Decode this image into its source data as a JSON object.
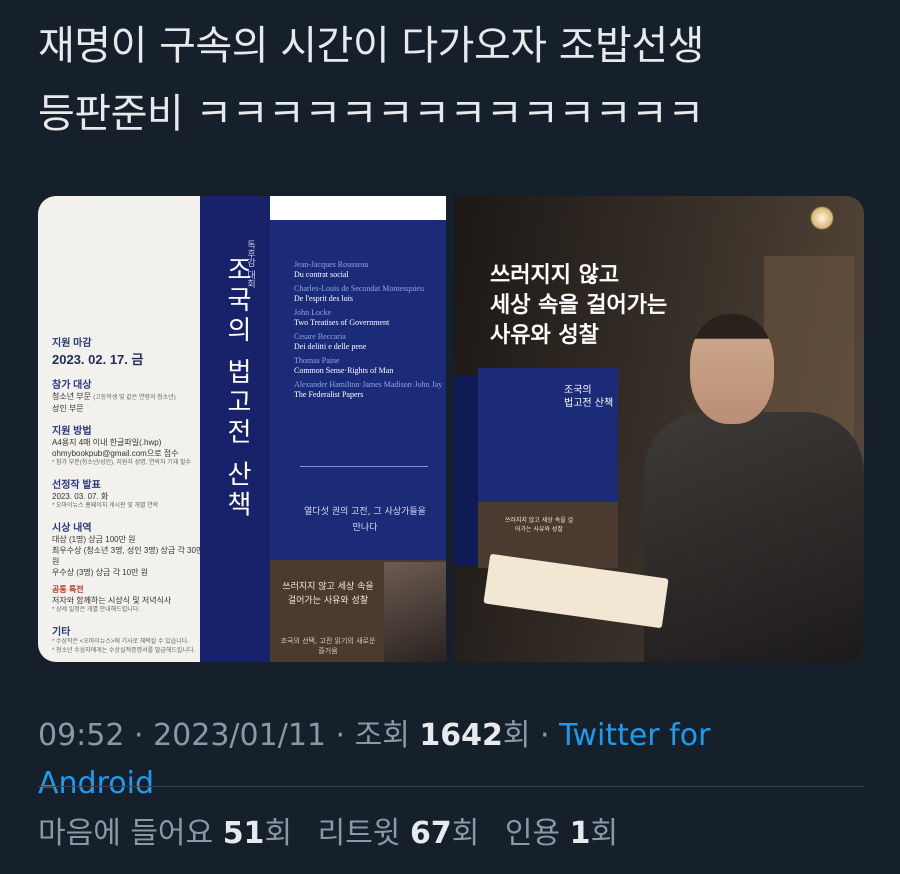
{
  "tweet": {
    "text_line1": "재명이 구속의 시간이 다가오자 조밥선생",
    "text_line2": "등판준비 ㅋㅋㅋㅋㅋㅋㅋㅋㅋㅋㅋㅋㅋㅋ"
  },
  "poster_left": {
    "section_deadline": "지원 마감",
    "deadline_date": "2023. 02. 17. 금",
    "section_target": "참가 대상",
    "target_youth": "청소년 부문",
    "target_youth_note": "(고등학생 및 같은 연령의 청소년)",
    "target_adult": "성인 부문",
    "section_method": "지원 방법",
    "method_1": "A4용지 4매 이내 한글파일(.hwp)",
    "method_email": "ohmybookpub@gmail.com으로 접수",
    "method_note": "* 참가 부문(청소년/성인), 지원자 성명, 연락처 기재 필수",
    "section_select": "선정작 발표",
    "select_date": "2023. 03. 07. 화",
    "select_note": "* 오마이뉴스 홈페이지 게시판 및 개별 연락",
    "section_award": "시상 내역",
    "award_1": "대상 (1명) 상금 100만 원",
    "award_2": "최우수상 (청소년 3명, 성인 3명) 상금 각 30만 원",
    "award_3": "우수상 (3명) 상금 각 10만 원",
    "section_special": "공통 특전",
    "special_1": "저자와 함께하는 시상식 및 저녁식사",
    "special_note": "* 상세 일정은 개별 안내해드립니다.",
    "section_etc": "기타",
    "etc_1": "* 수상작은 <오마이뉴스>에 기사로 채택될 수 있습니다.",
    "etc_2": "* 청소년 수상자에게는 수상실적증명서를 발급해드립니다.",
    "spine_sub": "독후감 대회",
    "spine_title": "조국의 법고전 산책",
    "cover_list": [
      {
        "author": "Jean-Jacques Rousseau",
        "title": "Du contrat social"
      },
      {
        "author": "Charles-Louis de Secondat Montesquieu",
        "title": "De l'esprit des lois"
      },
      {
        "author": "John Locke",
        "title": "Two Treatises of Government"
      },
      {
        "author": "Cesare Beccaria",
        "title": "Dei delitti e delle pene"
      },
      {
        "author": "Thomas Paine",
        "title": "Common Sense·Rights of Man"
      },
      {
        "author": "Alexander Hamilton·James Madison·John Jay",
        "title": "The Federalist Papers"
      }
    ],
    "cover_tag": "열다섯 권의 고전, 그 사상가들을 만나다",
    "bottom_tag": "쓰러지지 않고 세상 속을 걸어가는 사유와 성찰",
    "bottom_sub": "조국의 선택, 고전 읽기의 새로운 즐거움"
  },
  "photo_right": {
    "headline_1": "쓰러지지 않고",
    "headline_2": "세상 속을 걸어가는",
    "headline_3": "사유와 성찰",
    "box_title_1": "조국의",
    "box_title_2": "법고전 산책",
    "box_tag": "쓰러지지 않고 세상 속을 걸어가는 사유와 성찰"
  },
  "meta": {
    "time": "09:52",
    "sep1": " · ",
    "date": "2023/01/11",
    "sep2": " · ",
    "views_label": "조회 ",
    "views_count": "1642",
    "views_suffix": "회",
    "sep3": " · ",
    "source_line1": "Twitter for",
    "source_line2": "Android"
  },
  "stats": {
    "likes_label": "마음에 들어요 ",
    "likes_count": "51",
    "likes_suffix": "회",
    "retweets_label": "리트윗 ",
    "retweets_count": "67",
    "retweets_suffix": "회",
    "quotes_label": "인용 ",
    "quotes_count": "1",
    "quotes_suffix": "회"
  }
}
